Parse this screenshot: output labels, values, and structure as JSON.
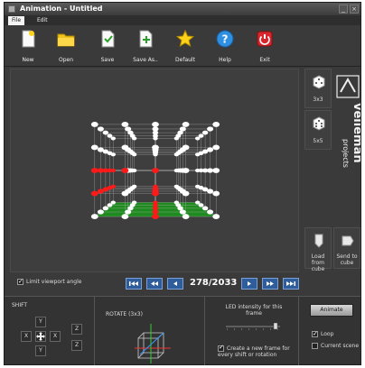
{
  "window": {
    "title": "Animation - Untitled"
  },
  "menu": [
    {
      "label": "File"
    },
    {
      "label": "Edit"
    }
  ],
  "toolbar": [
    {
      "label": "New",
      "icon": "new-document-icon"
    },
    {
      "label": "Open",
      "icon": "folder-icon"
    },
    {
      "label": "Save",
      "icon": "save-icon"
    },
    {
      "label": "Save As..",
      "icon": "save-as-icon"
    },
    {
      "label": "Default",
      "icon": "star-icon"
    },
    {
      "label": "Help",
      "icon": "help-icon"
    },
    {
      "label": "Exit",
      "icon": "exit-icon"
    }
  ],
  "side": {
    "cube3": "3x3",
    "cube5": "5x5",
    "load_cube": "Load from cube",
    "send_cube": "Send to cube",
    "brand": "velleman",
    "brand_sub": "projects"
  },
  "nav": {
    "limit_label": "Limit viewport angle",
    "limit_checked": true,
    "frame": "278/2033"
  },
  "shift": {
    "title": "SHIFT",
    "keys": [
      "Y",
      "X",
      "X",
      "Y",
      "Z",
      "Z"
    ]
  },
  "rotate": {
    "title": "ROTATE (3x3)"
  },
  "led": {
    "title": "LED intensity for this frame",
    "new_frame_label": "Create a new frame for every shift or rotation",
    "new_frame_checked": true
  },
  "anim": {
    "button": "Animate",
    "loop_label": "Loop",
    "loop_checked": true,
    "current_label": "Current scene",
    "current_checked": false
  },
  "colors": {
    "led_on": "#ff1a1a",
    "led_off": "#ffffff",
    "floor": "#1f8a1f",
    "accent": "#2f5c9a"
  }
}
